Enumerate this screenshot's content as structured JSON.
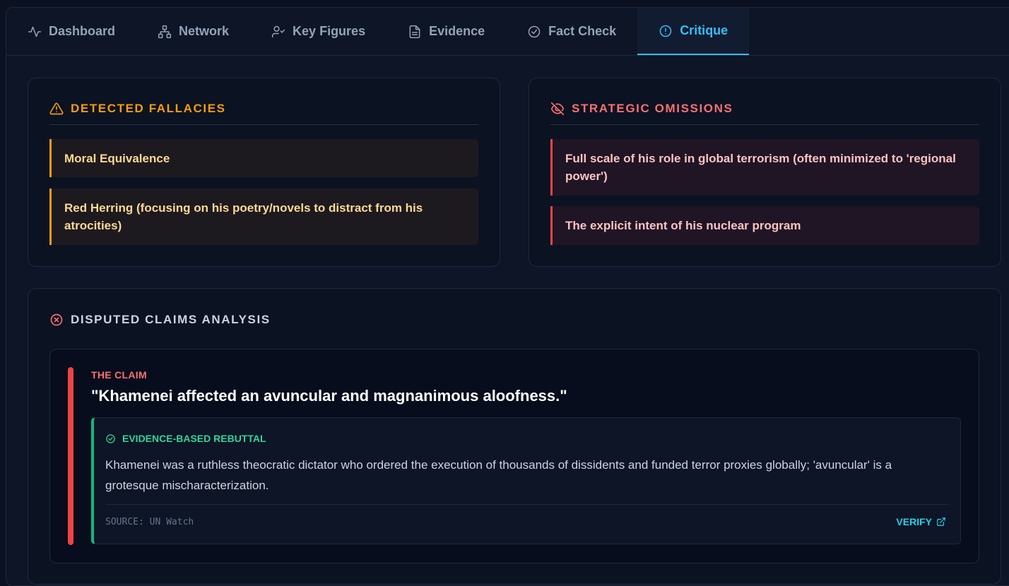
{
  "tabs": [
    {
      "label": "Dashboard",
      "icon": "activity-icon"
    },
    {
      "label": "Network",
      "icon": "network-icon"
    },
    {
      "label": "Key Figures",
      "icon": "user-check-icon"
    },
    {
      "label": "Evidence",
      "icon": "file-text-icon"
    },
    {
      "label": "Fact Check",
      "icon": "check-circle-icon"
    },
    {
      "label": "Critique",
      "icon": "alert-circle-icon",
      "active": true
    }
  ],
  "fallacies": {
    "title": "Detected Fallacies",
    "items": [
      "Moral Equivalence",
      "Red Herring (focusing on his poetry/novels to distract from his atrocities)"
    ]
  },
  "omissions": {
    "title": "Strategic Omissions",
    "items": [
      "Full scale of his role in global terrorism (often minimized to 'regional power')",
      "The explicit intent of his nuclear program"
    ]
  },
  "disputed": {
    "title": "Disputed Claims Analysis",
    "claim_label": "The Claim",
    "claim_text": "\"Khamenei affected an avuncular and magnanimous aloofness.\"",
    "rebuttal_label": "Evidence-Based Rebuttal",
    "rebuttal_text": "Khamenei was a ruthless theocratic dictator who ordered the execution of thousands of dissidents and funded terror proxies globally; 'avuncular' is a grotesque mischaracterization.",
    "source": "SOURCE: UN Watch",
    "verify_label": "VERIFY"
  },
  "colors": {
    "accent": "#38bdf8",
    "warning": "#f59e0b",
    "danger": "#ef4444",
    "success": "#10b981"
  }
}
